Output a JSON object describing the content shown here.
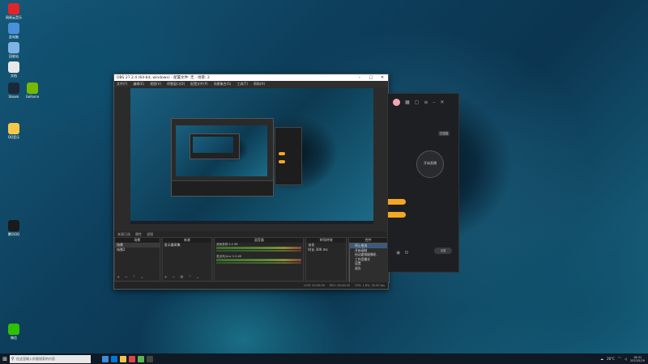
{
  "desktop": {
    "icons": [
      {
        "label": "网易云音乐",
        "icon": "music-icon",
        "color": "#e0262a"
      },
      {
        "label": "此电脑",
        "icon": "computer-icon",
        "color": "#4a90d9"
      },
      {
        "label": "回收站",
        "icon": "recycle-bin-icon",
        "color": "#7fb2e5"
      },
      {
        "label": "文档",
        "icon": "document-icon",
        "color": "#e8e8e8"
      },
      {
        "label": "Steam",
        "icon": "steam-icon",
        "color": "#1b2838"
      },
      {
        "label": "GeForce",
        "icon": "nvidia-icon",
        "color": "#76b900"
      },
      {
        "label": "QQ音乐",
        "icon": "qq-music-icon",
        "color": "#f7c948"
      },
      {
        "label": "腾讯QQ",
        "icon": "qq-icon",
        "color": "#1a1a1a"
      },
      {
        "label": "微信",
        "icon": "wechat-icon",
        "color": "#2dc100"
      }
    ]
  },
  "obs": {
    "title": "OBS 27.2.4 (64-bit, windows) - 配置文件: 无 - 场景: 2",
    "menu": [
      "文件(F)",
      "编辑(E)",
      "视图(V)",
      "停靠窗口(D)",
      "配置文件(P)",
      "场景集合(S)",
      "工具(T)",
      "帮助(H)"
    ],
    "scenebar": [
      "来源已选",
      "属性",
      "滤镜"
    ],
    "docks": {
      "scenes": {
        "header": "场景",
        "items": [
          "场景",
          "场景2"
        ]
      },
      "sources": {
        "header": "来源",
        "items": [
          "显示器采集"
        ]
      },
      "mixer": {
        "header": "混音器",
        "channels": [
          {
            "name": "桌面音频",
            "level": "0.0 dB"
          },
          {
            "name": "麦克风/Aux",
            "level": "0.0 dB"
          }
        ]
      },
      "transitions": {
        "header": "转场特效",
        "type": "淡化",
        "duration_label": "时长",
        "duration": "300 ms"
      },
      "controls": {
        "header": "控件"
      }
    },
    "context_menu": [
      "停止推流",
      "开始录制",
      "启动虚拟摄像机",
      "工作室模式",
      "设置",
      "退出"
    ],
    "context_highlight": 0,
    "status": [
      "LIVE: 00:00:00",
      "REC: 00:00:00",
      "CPU: 1.8%, 30.00 fps"
    ]
  },
  "right_panel": {
    "badge": "已连接",
    "circle_label": "开始直播",
    "pill": "设置"
  },
  "taskbar": {
    "search_placeholder": "在这里输入你要搜索的内容",
    "temperature": "26°C",
    "time": "16:31",
    "date": "2022/5/29"
  }
}
